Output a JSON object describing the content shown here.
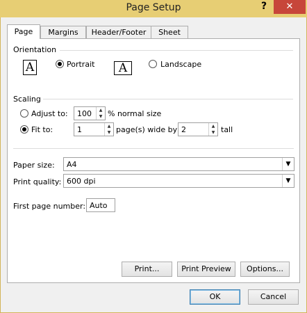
{
  "window": {
    "title": "Page Setup",
    "help": "?",
    "close": "✕"
  },
  "tabs": [
    "Page",
    "Margins",
    "Header/Footer",
    "Sheet"
  ],
  "orientation": {
    "group": "Orientation",
    "portrait": "Portrait",
    "landscape": "Landscape",
    "selected": "portrait",
    "icon_letter": "A"
  },
  "scaling": {
    "group": "Scaling",
    "adjust_label": "Adjust to:",
    "adjust_value": "100",
    "adjust_suffix": "% normal size",
    "fit_label": "Fit to:",
    "fit_wide": "1",
    "fit_wide_suffix": "page(s) wide by",
    "fit_tall": "2",
    "fit_tall_suffix": "tall",
    "selected": "fit"
  },
  "paper_size": {
    "label": "Paper size:",
    "value": "A4"
  },
  "print_quality": {
    "label": "Print quality:",
    "value": "600 dpi"
  },
  "first_page": {
    "label": "First page number:",
    "value": "Auto"
  },
  "buttons": {
    "print": "Print...",
    "preview": "Print Preview",
    "options": "Options...",
    "ok": "OK",
    "cancel": "Cancel"
  }
}
